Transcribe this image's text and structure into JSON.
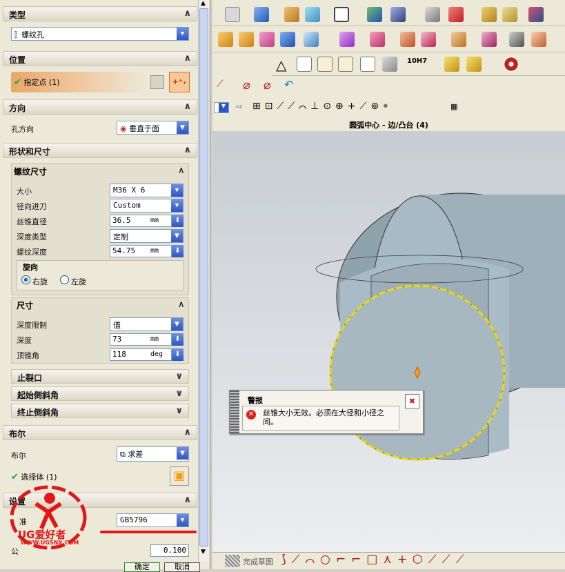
{
  "dialog": {
    "type_section": {
      "title": "类型",
      "value": "螺纹孔"
    },
    "position_section": {
      "title": "位置",
      "point_label": "指定点 (1)"
    },
    "direction_section": {
      "title": "方向",
      "hole_dir_label": "孔方向",
      "hole_dir_value": "垂直于面"
    },
    "shape_section": {
      "title": "形状和尺寸"
    },
    "thread": {
      "title": "螺纹尺寸",
      "size_label": "大小",
      "size_value": "M36 X 6",
      "radial_label": "径向进刀",
      "radial_value": "Custom",
      "tap_dia_label": "丝锥直径",
      "tap_dia_value": "36.5",
      "tap_dia_unit": "mm",
      "depth_type_label": "深度类型",
      "depth_type_value": "定制",
      "thread_depth_label": "螺纹深度",
      "thread_depth_value": "54.75",
      "thread_depth_unit": "mm",
      "rotation_title": "旋向",
      "right_label": "右旋",
      "left_label": "左旋"
    },
    "dims": {
      "title": "尺寸",
      "depth_limit_label": "深度限制",
      "depth_limit_value": "值",
      "depth_label": "深度",
      "depth_value": "73",
      "depth_unit": "mm",
      "tip_label": "顶锥角",
      "tip_value": "118",
      "tip_unit": "deg"
    },
    "relief_title": "止裂口",
    "start_chamfer_title": "起始倒斜角",
    "end_chamfer_title": "终止倒斜角",
    "boolean_section": {
      "title": "布尔",
      "label": "布尔",
      "value": "求差",
      "body_label": "选择体 (1)"
    },
    "settings_section": {
      "title": "设置",
      "std_label": "准",
      "std_value": "GB5796",
      "tol_label": "公",
      "tol_value": "0.100"
    },
    "ok_label": "确定",
    "cancel_label": "取消"
  },
  "status_text": "圆弧中心 - 边/凸台 (4)",
  "warning": {
    "title": "警报",
    "message": "丝锥大小无效。必须在大径和小径之间。"
  },
  "bottom": {
    "sketch_label": "完成草图"
  },
  "toolbar_labels": {
    "tolerance_label": "10H7"
  },
  "watermark": {
    "brand": "UG爱好者",
    "url": "WWW.UGSNX.COM"
  }
}
